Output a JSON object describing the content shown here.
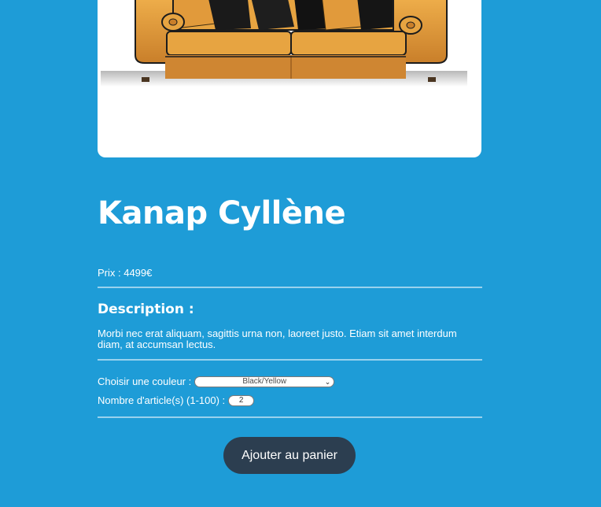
{
  "product": {
    "image_alt": "Photographie d'un canapé",
    "name": "Kanap Cyllène",
    "price_label": "Prix : 4499€",
    "description_title": "Description :",
    "description": "Morbi nec erat aliquam, sagittis urna non, laoreet justo. Etiam sit amet interdum diam, at accumsan lectus."
  },
  "options": {
    "color_label": "Choisir une couleur :",
    "color_selected": "Black/Yellow",
    "quantity_label": "Nombre d'article(s) (1-100) :",
    "quantity_value": "2"
  },
  "actions": {
    "add_to_cart_label": "Ajouter au panier"
  },
  "colors": {
    "background": "#1e9cd7",
    "button": "#2c3e50",
    "sofa": "#e19a3b",
    "cushion_dark": "#1a1a1a"
  }
}
